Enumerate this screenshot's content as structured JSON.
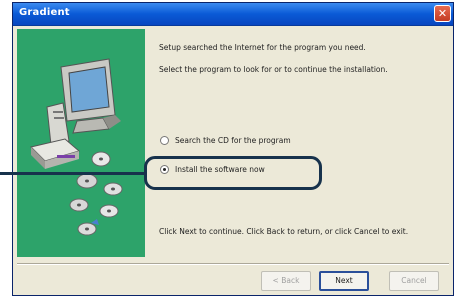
{
  "window": {
    "title": "Gradient",
    "close_glyph": "✕"
  },
  "intro": {
    "line1": "Setup searched the Internet for the program you need.",
    "line2": "Select the program to look for or to continue the installation."
  },
  "options": [
    {
      "label": "Search the CD for the program",
      "checked": false
    },
    {
      "label": "Install the software now",
      "checked": true
    }
  ],
  "footer_text": "Click Next to continue. Click Back to return, or click Cancel to exit.",
  "buttons": {
    "back": "< Back",
    "next": "Next",
    "cancel": "Cancel"
  },
  "colors": {
    "illustration_bg": "#2da36a",
    "callout": "#17324c",
    "titlebar": "#0a5ad6"
  },
  "icons": [
    "computer-icon",
    "cd-icon",
    "close-icon"
  ]
}
